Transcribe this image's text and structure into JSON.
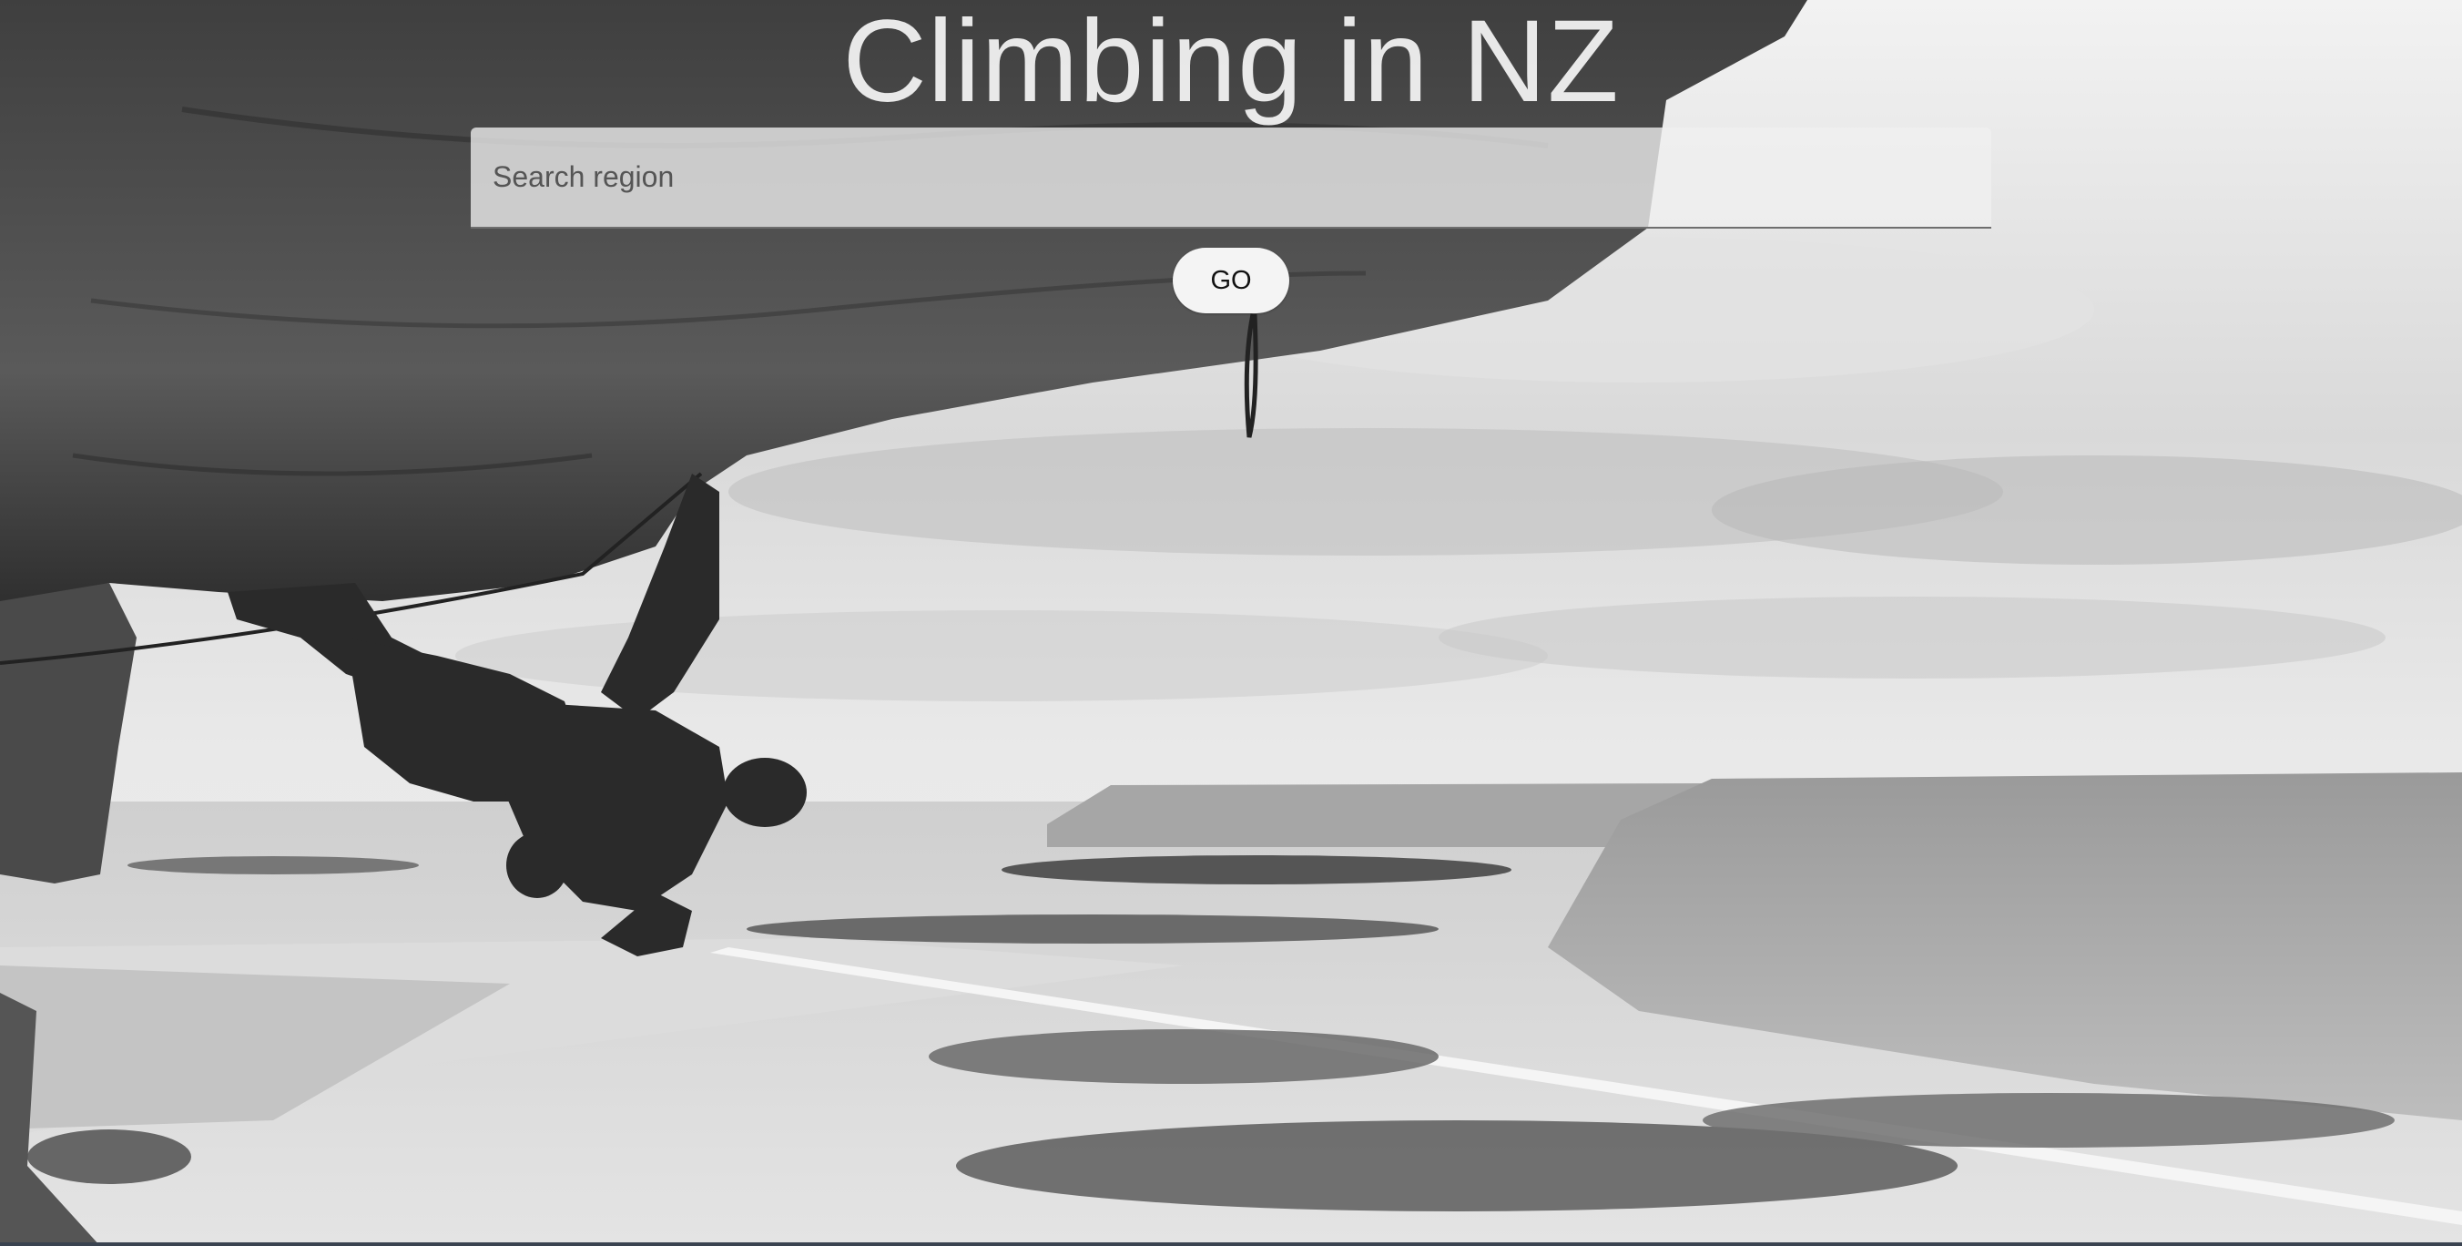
{
  "header": {
    "title": "Climbing in NZ"
  },
  "search": {
    "placeholder": "Search region",
    "value": ""
  },
  "actions": {
    "go_label": "GO"
  },
  "background": {
    "description_icon": "climber-photo"
  },
  "colors": {
    "title": "#f5f5f5",
    "search_bg": "#f0f0f0",
    "button_bg": "#f4f4f4",
    "button_text": "#111111"
  }
}
